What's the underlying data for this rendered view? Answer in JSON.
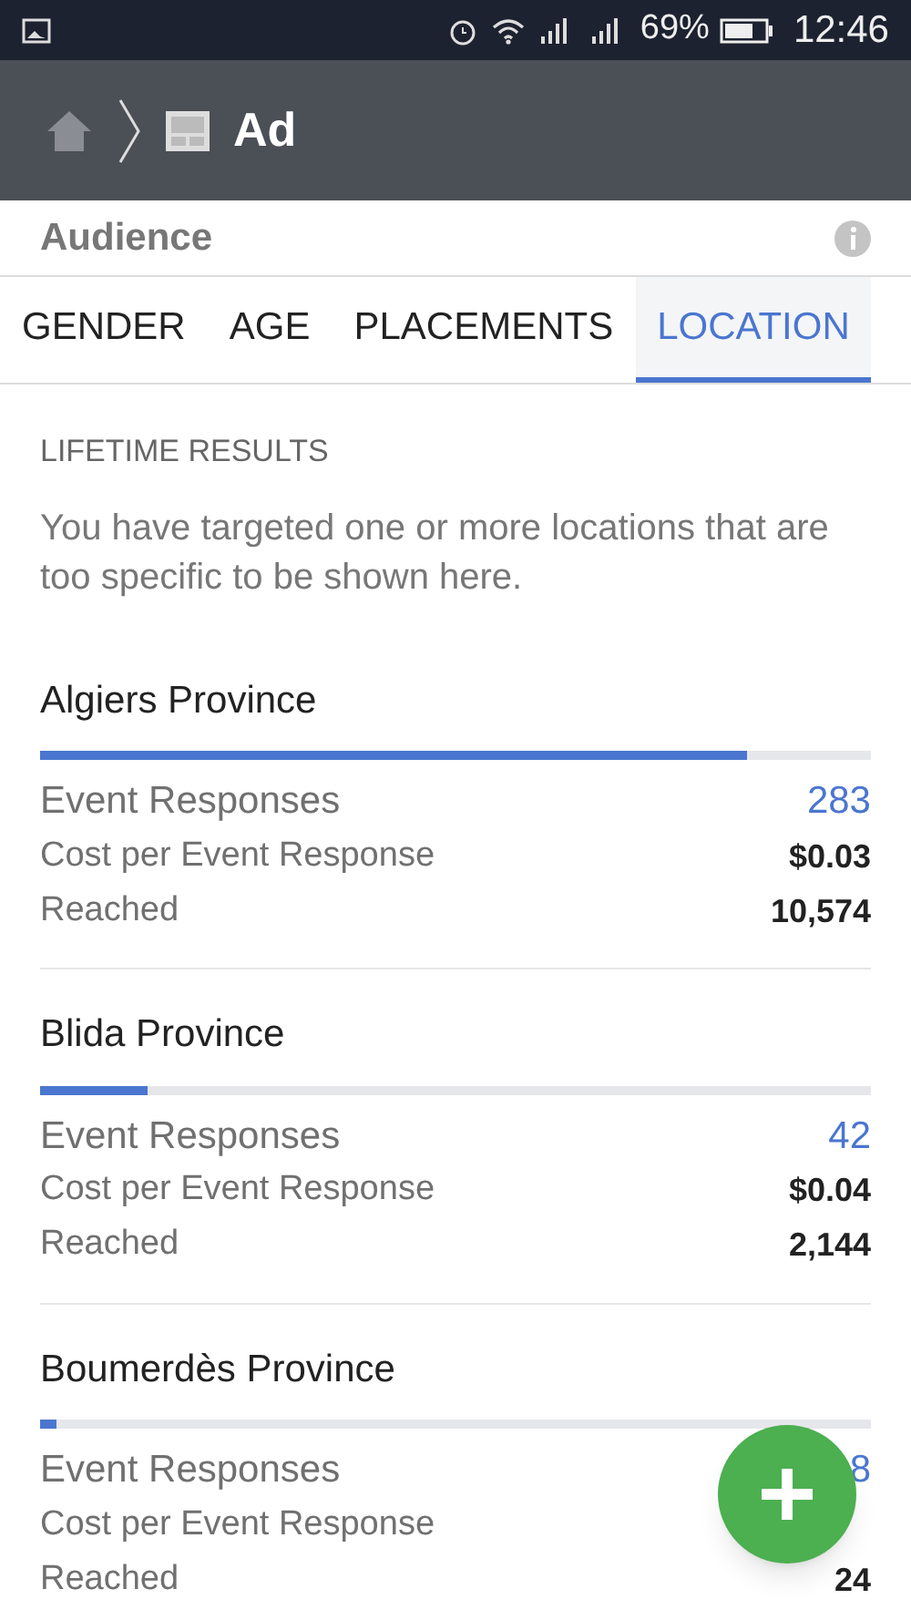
{
  "status_bar": {
    "battery": "69%",
    "time": "12:46"
  },
  "header": {
    "title": "Ad"
  },
  "section": {
    "title": "Audience"
  },
  "tabs": [
    {
      "label": "GENDER",
      "selected": false
    },
    {
      "label": "AGE",
      "selected": false
    },
    {
      "label": "PLACEMENTS",
      "selected": false
    },
    {
      "label": "LOCATION",
      "selected": true
    }
  ],
  "results": {
    "heading": "LIFETIME RESULTS",
    "note": "You have targeted one or more locations that are too specific to be shown here.",
    "locations": [
      {
        "name": "Algiers Province",
        "level": 0.85,
        "stats": [
          {
            "label": "Event Responses",
            "value": "283",
            "kind": "primary"
          },
          {
            "label": "Cost per Event Response",
            "value": "$0.03",
            "kind": "secondary"
          },
          {
            "label": "Reached",
            "value": "10,574",
            "kind": "secondary"
          }
        ]
      },
      {
        "name": "Blida Province",
        "level": 0.13,
        "stats": [
          {
            "label": "Event Responses",
            "value": "42",
            "kind": "primary"
          },
          {
            "label": "Cost per Event Response",
            "value": "$0.04",
            "kind": "secondary"
          },
          {
            "label": "Reached",
            "value": "2,144",
            "kind": "secondary"
          }
        ]
      },
      {
        "name": "Boumerdès Province",
        "level": 0.02,
        "stats": [
          {
            "label": "Event Responses",
            "value": "8",
            "kind": "primary"
          },
          {
            "label": "Cost per Event Response",
            "kind": "secondary"
          },
          {
            "label": "Reached",
            "value": "24",
            "kind": "secondary"
          }
        ]
      }
    ]
  }
}
